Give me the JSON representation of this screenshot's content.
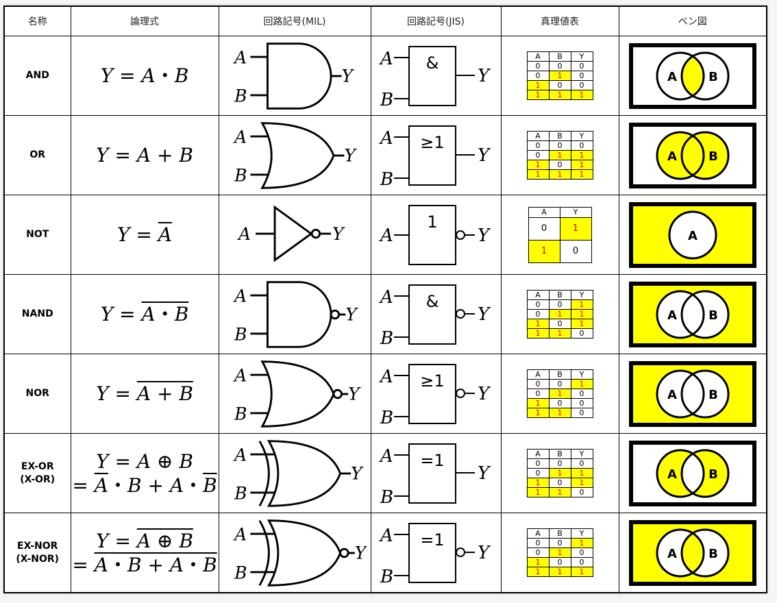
{
  "headers": [
    "名称",
    "論理式",
    "回路記号(MIL)",
    "回路記号(JIS)",
    "真理値表",
    "ベン図"
  ],
  "labels": {
    "A": "A",
    "B": "B",
    "Y": "Y"
  },
  "colors": {
    "highlight": "#ffff00",
    "on_text": "#e00000",
    "line": "#000000"
  },
  "rows": [
    {
      "name": "AND",
      "expr": [
        "Y = A・B"
      ],
      "jis_symbol": "&",
      "jis_negated": false,
      "truth": [
        [
          "0",
          "0",
          "0"
        ],
        [
          "0",
          "1",
          "0"
        ],
        [
          "1",
          "0",
          "0"
        ],
        [
          "1",
          "1",
          "1"
        ]
      ],
      "venn": "and"
    },
    {
      "name": "OR",
      "expr": [
        "Y = A + B"
      ],
      "jis_symbol": "≥1",
      "jis_negated": false,
      "truth": [
        [
          "0",
          "0",
          "0"
        ],
        [
          "0",
          "1",
          "1"
        ],
        [
          "1",
          "0",
          "1"
        ],
        [
          "1",
          "1",
          "1"
        ]
      ],
      "venn": "or"
    },
    {
      "name": "NOT",
      "expr": [
        "Y = Ā"
      ],
      "jis_symbol": "1",
      "jis_negated": true,
      "truth": [
        [
          "0",
          "1"
        ],
        [
          "1",
          "0"
        ]
      ],
      "venn": "not"
    },
    {
      "name": "NAND",
      "expr": [
        "Y = A・B (overline)"
      ],
      "jis_symbol": "&",
      "jis_negated": true,
      "truth": [
        [
          "0",
          "0",
          "1"
        ],
        [
          "0",
          "1",
          "1"
        ],
        [
          "1",
          "0",
          "1"
        ],
        [
          "1",
          "1",
          "0"
        ]
      ],
      "venn": "nand"
    },
    {
      "name": "NOR",
      "expr": [
        "Y = A + B (overline)"
      ],
      "jis_symbol": "≥1",
      "jis_negated": true,
      "truth": [
        [
          "0",
          "0",
          "1"
        ],
        [
          "0",
          "1",
          "0"
        ],
        [
          "1",
          "0",
          "0"
        ],
        [
          "1",
          "1",
          "0"
        ]
      ],
      "venn": "nor"
    },
    {
      "name": "EX-OR\n(X-OR)",
      "expr": [
        "Y = A ⊕ B",
        "= Ā・B + A・B̄"
      ],
      "jis_symbol": "=1",
      "jis_negated": false,
      "truth": [
        [
          "0",
          "0",
          "0"
        ],
        [
          "0",
          "1",
          "1"
        ],
        [
          "1",
          "0",
          "1"
        ],
        [
          "1",
          "1",
          "0"
        ]
      ],
      "venn": "xor"
    },
    {
      "name": "EX-NOR\n(X-NOR)",
      "expr": [
        "Y = A ⊕ B (overline)",
        "= Ā・B + A・B̄ (overline)"
      ],
      "jis_symbol": "=1",
      "jis_negated": true,
      "truth": [
        [
          "0",
          "0",
          "1"
        ],
        [
          "0",
          "1",
          "0"
        ],
        [
          "1",
          "0",
          "0"
        ],
        [
          "1",
          "1",
          "1"
        ]
      ],
      "venn": "xnor"
    }
  ]
}
